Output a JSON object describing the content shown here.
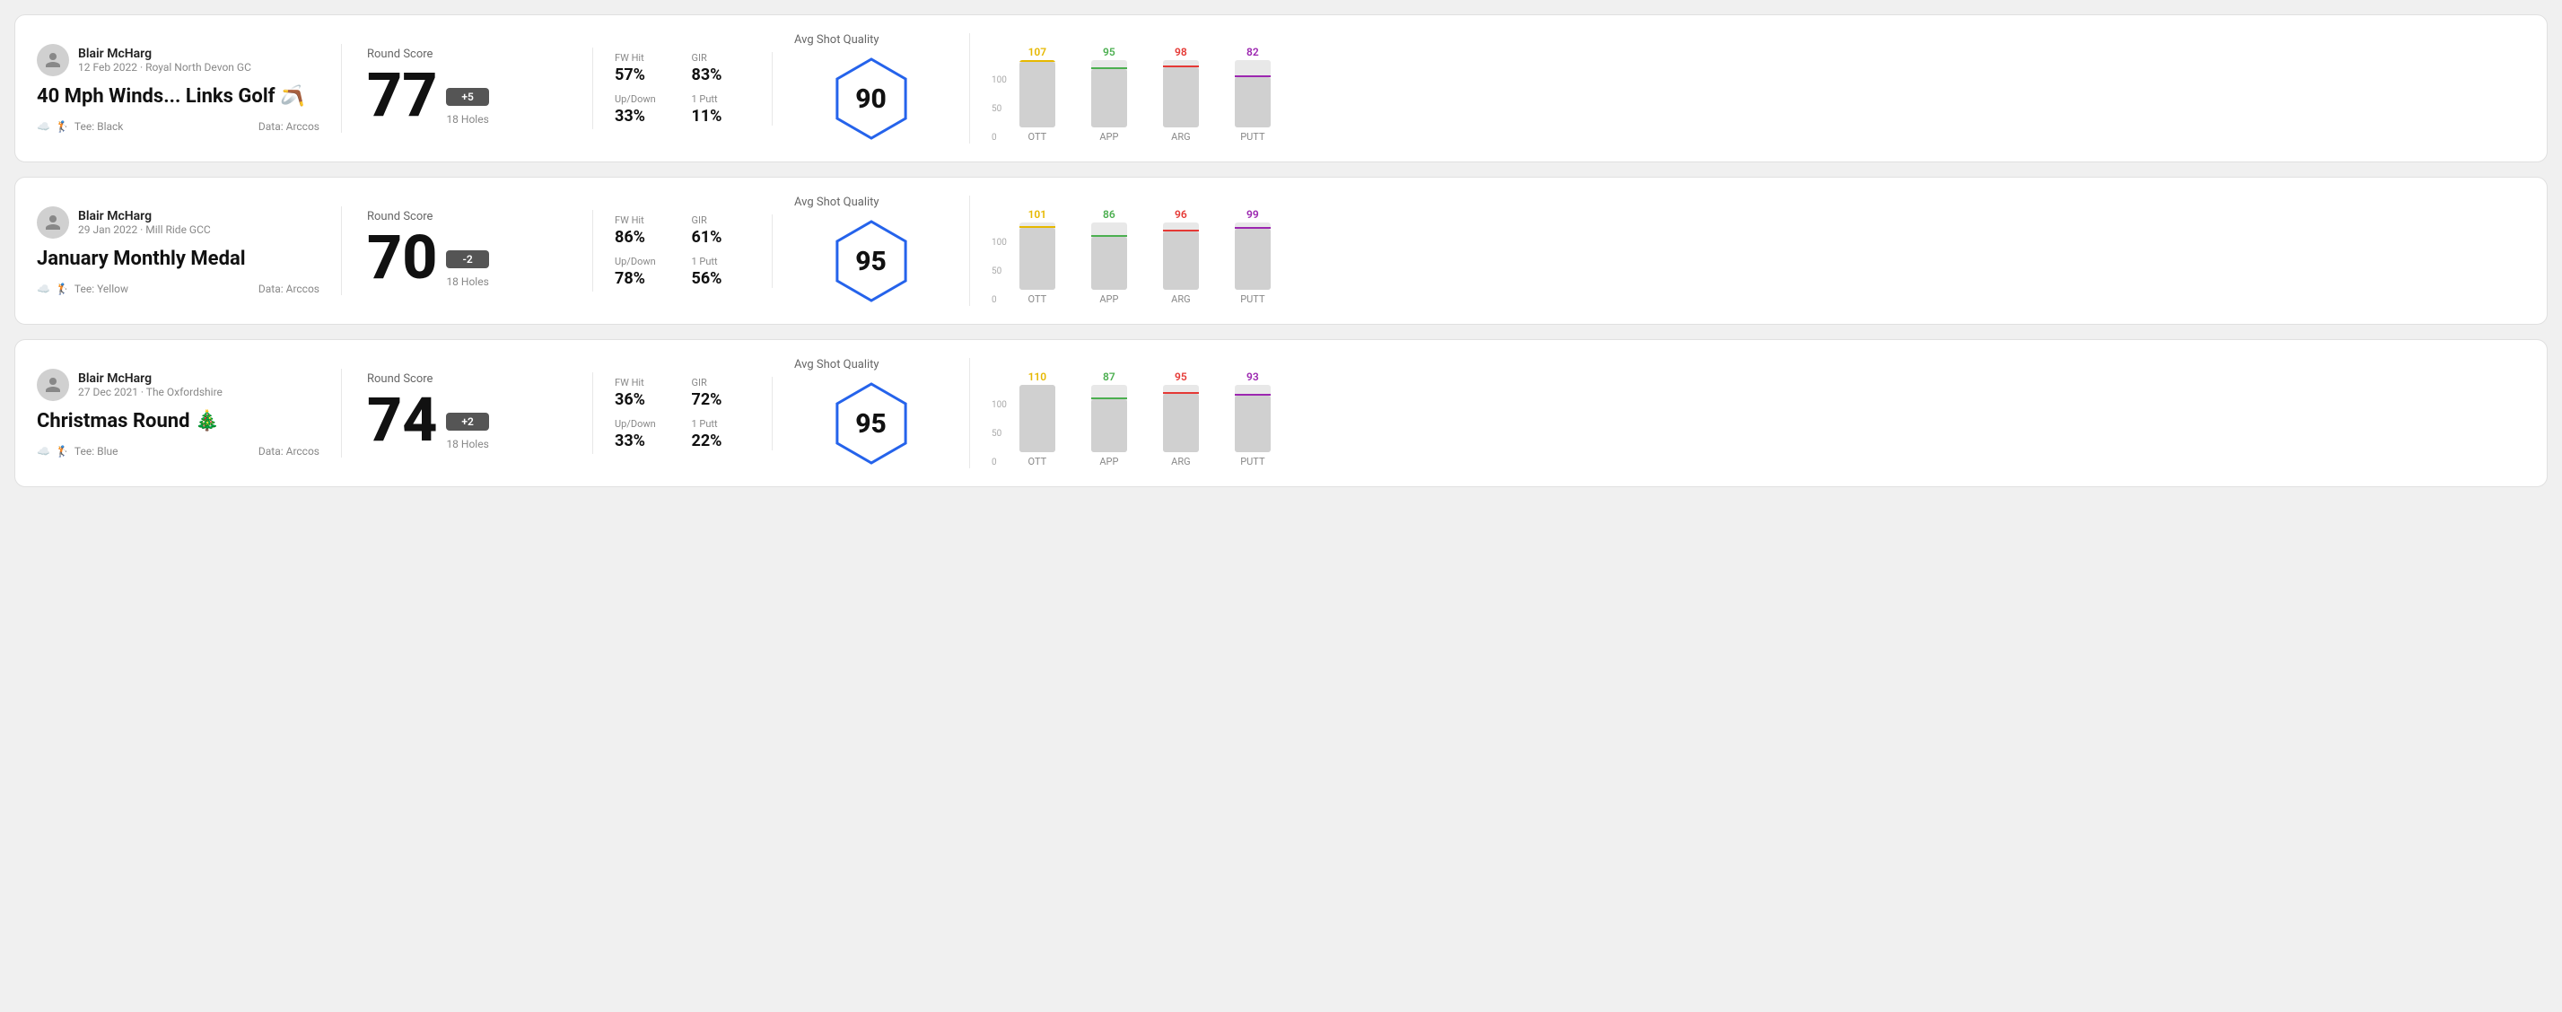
{
  "cards": [
    {
      "id": "round1",
      "user": {
        "name": "Blair McHarg",
        "meta": "12 Feb 2022 · Royal North Devon GC"
      },
      "title": "40 Mph Winds... Links Golf",
      "title_emoji": "🪃",
      "tee": "Black",
      "data_source": "Data: Arccos",
      "round_score_label": "Round Score",
      "score": "77",
      "score_diff": "+5",
      "holes": "18 Holes",
      "fw_hit": "57%",
      "gir": "83%",
      "up_down": "33%",
      "one_putt": "11%",
      "avg_quality_label": "Avg Shot Quality",
      "quality_score": "90",
      "chart": {
        "columns": [
          {
            "label": "OTT",
            "value": 107,
            "color": "#e6b800"
          },
          {
            "label": "APP",
            "value": 95,
            "color": "#4caf50"
          },
          {
            "label": "ARG",
            "value": 98,
            "color": "#e53935"
          },
          {
            "label": "PUTT",
            "value": 82,
            "color": "#9c27b0"
          }
        ]
      }
    },
    {
      "id": "round2",
      "user": {
        "name": "Blair McHarg",
        "meta": "29 Jan 2022 · Mill Ride GCC"
      },
      "title": "January Monthly Medal",
      "title_emoji": "",
      "tee": "Yellow",
      "data_source": "Data: Arccos",
      "round_score_label": "Round Score",
      "score": "70",
      "score_diff": "-2",
      "holes": "18 Holes",
      "fw_hit": "86%",
      "gir": "61%",
      "up_down": "78%",
      "one_putt": "56%",
      "avg_quality_label": "Avg Shot Quality",
      "quality_score": "95",
      "chart": {
        "columns": [
          {
            "label": "OTT",
            "value": 101,
            "color": "#e6b800"
          },
          {
            "label": "APP",
            "value": 86,
            "color": "#4caf50"
          },
          {
            "label": "ARG",
            "value": 96,
            "color": "#e53935"
          },
          {
            "label": "PUTT",
            "value": 99,
            "color": "#9c27b0"
          }
        ]
      }
    },
    {
      "id": "round3",
      "user": {
        "name": "Blair McHarg",
        "meta": "27 Dec 2021 · The Oxfordshire"
      },
      "title": "Christmas Round",
      "title_emoji": "🎄",
      "tee": "Blue",
      "data_source": "Data: Arccos",
      "round_score_label": "Round Score",
      "score": "74",
      "score_diff": "+2",
      "holes": "18 Holes",
      "fw_hit": "36%",
      "gir": "72%",
      "up_down": "33%",
      "one_putt": "22%",
      "avg_quality_label": "Avg Shot Quality",
      "quality_score": "95",
      "chart": {
        "columns": [
          {
            "label": "OTT",
            "value": 110,
            "color": "#e6b800"
          },
          {
            "label": "APP",
            "value": 87,
            "color": "#4caf50"
          },
          {
            "label": "ARG",
            "value": 95,
            "color": "#e53935"
          },
          {
            "label": "PUTT",
            "value": 93,
            "color": "#9c27b0"
          }
        ]
      }
    }
  ],
  "labels": {
    "fw_hit": "FW Hit",
    "gir": "GIR",
    "up_down": "Up/Down",
    "one_putt": "1 Putt",
    "data": "Data: Arccos",
    "tee_prefix": "Tee:"
  },
  "chart_y": [
    "100",
    "50",
    "0"
  ]
}
